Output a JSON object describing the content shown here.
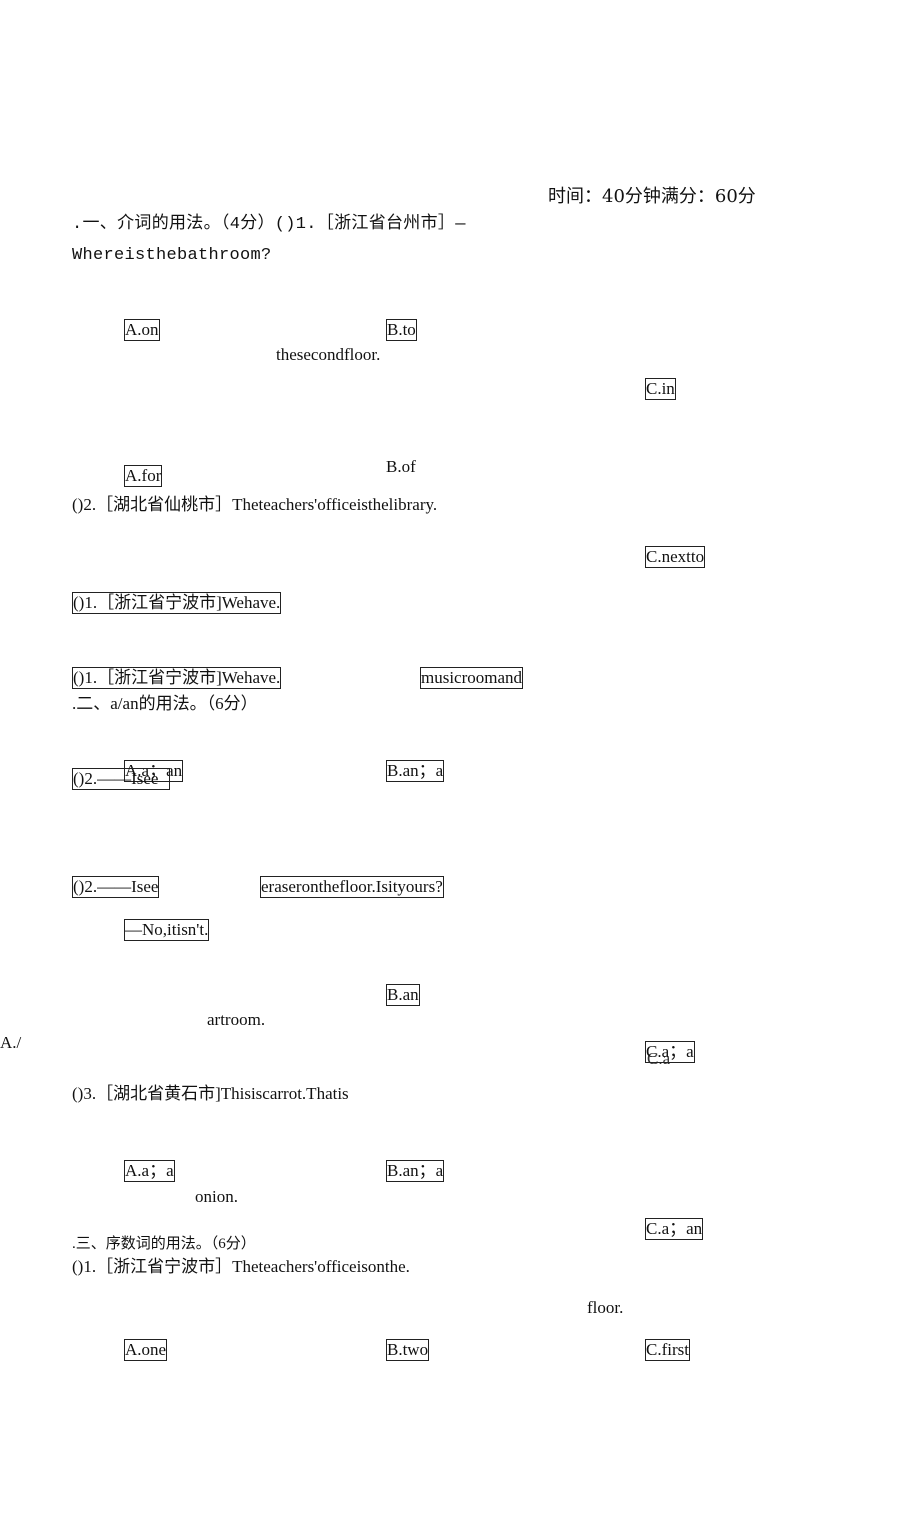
{
  "header": {
    "time_score": "时间：40分钟满分：60分"
  },
  "section1": {
    "heading_line": ".一、介词的用法。（4分）()1.［浙江省台州市］—",
    "q1_text": "Whereisthebathroom?",
    "q1_blank_tail": "thesecondfloor.",
    "q1_options": {
      "a": "A.on",
      "b": "B.to",
      "c": "C.in"
    },
    "q2_options": {
      "a": "A.for",
      "b": "B.of",
      "c": "C.nextto"
    },
    "q2_text": "()2.［湖北省仙桃市］Theteachers'officeisthelibrary."
  },
  "section2": {
    "repeat_q1_a": "()1.［浙江省宁波市]Wehave.",
    "repeat_q1_b": "()1.［浙江省宁波市]Wehave.",
    "q1_tail": "musicroomand",
    "heading": ".二、a/an的用法。（6分）",
    "q1_options": {
      "a": "A.a；an",
      "b": "B.an；a"
    },
    "q2_overlap": "()2.——Isee",
    "q2_text": "()2.——Isee",
    "q2_tail": "eraseronthefloor.Isityours?",
    "q2_reply": "—No,itisn't.",
    "q2_options": {
      "a": "A./",
      "b": "B.an",
      "c": "C.a；a",
      "c_ghost": "C.a"
    },
    "q1_tail2": "artroom.",
    "q3_text": "()3.［湖北省黄石市]Thisiscarrot.Thatis",
    "q3_options": {
      "a": "A.a；a",
      "b": "B.an；a",
      "c": "C.a；an"
    },
    "q3_tail": "onion."
  },
  "section3": {
    "heading": ".三、序数词的用法。（6分）",
    "q1_text": "()1.［浙江省宁波市］Theteachers'officeisonthe.",
    "q1_tail": "floor.",
    "q1_options": {
      "a": "A.one",
      "b": "B.two",
      "c": "C.first"
    }
  }
}
